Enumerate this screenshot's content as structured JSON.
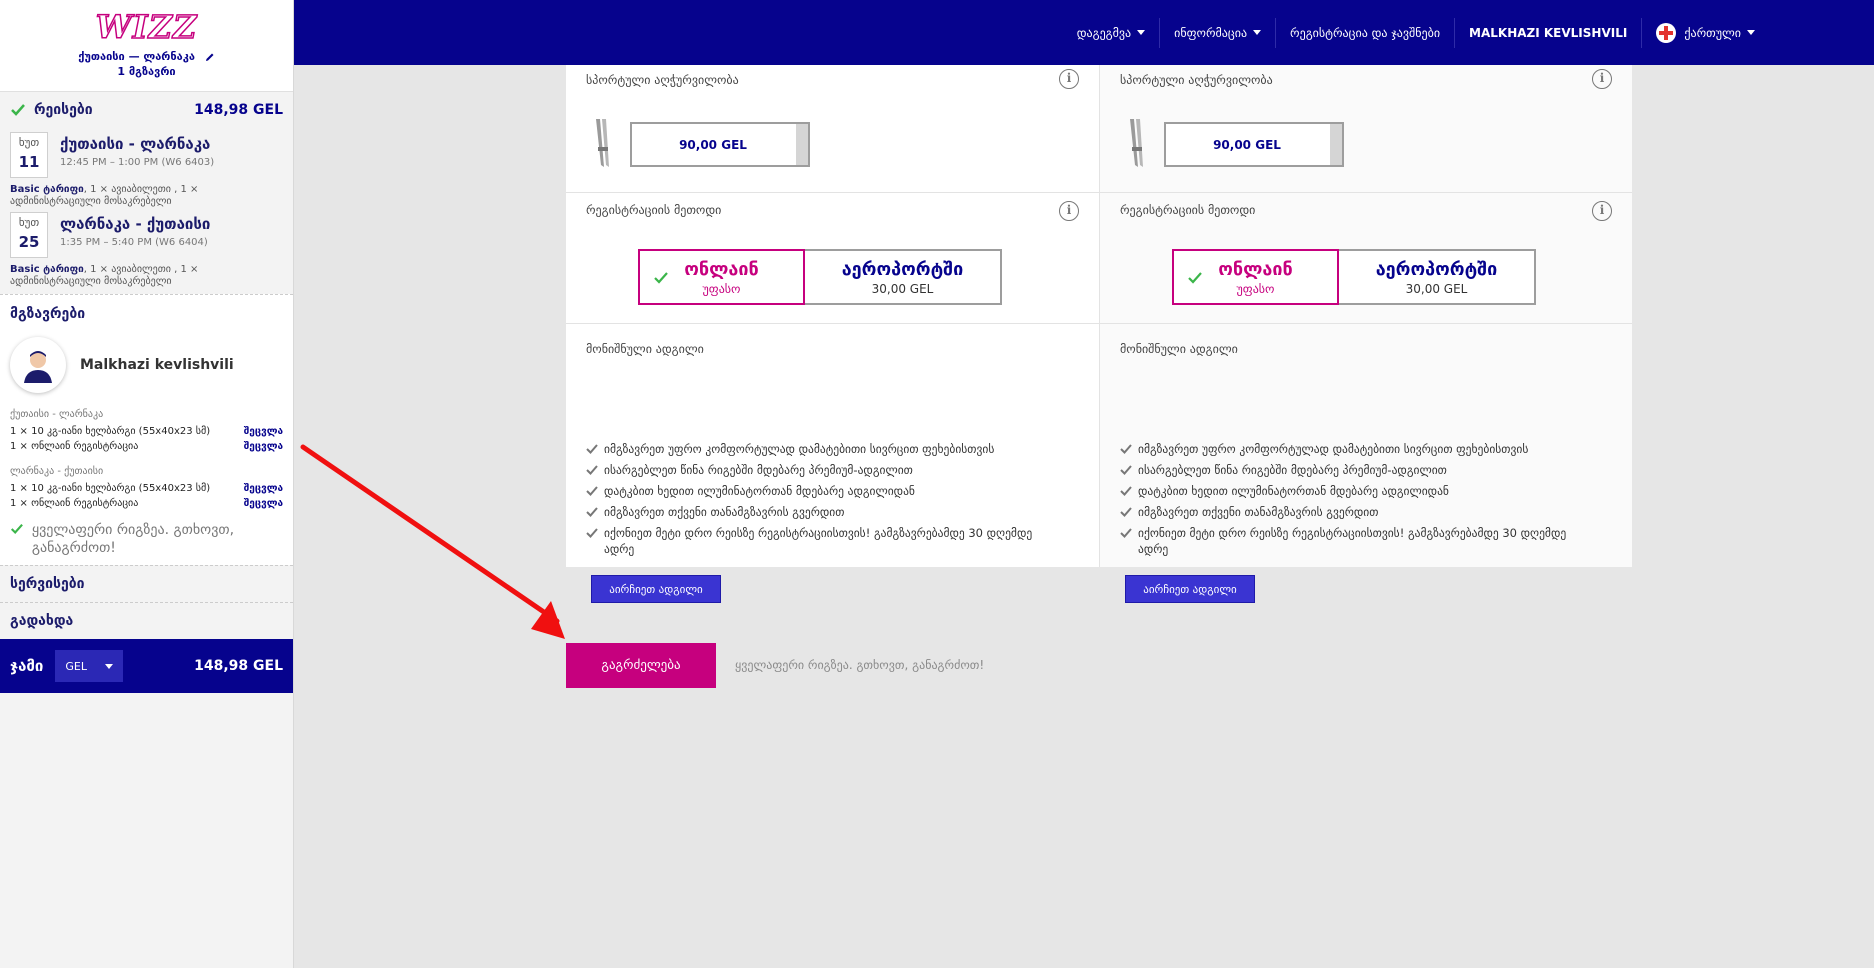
{
  "topbar": {
    "nav": [
      {
        "label": "დაგეგმვა",
        "caret": true
      },
      {
        "label": "ინფორმაცია",
        "caret": true
      },
      {
        "label": "რეგისტრაცია და ჯავშნები",
        "caret": false
      }
    ],
    "user": "MALKHAZI KEVLISHVILI",
    "language": "ქართული"
  },
  "sidebar": {
    "logo": "WIZZ",
    "route": "ქუთაისი — ლარნაკა",
    "pax_count": "1 მგზავრი",
    "flights_section": {
      "title": "რეისები",
      "price": "148,98 GEL"
    },
    "flights": [
      {
        "weekday": "ხუთ",
        "day": "11",
        "route": "ქუთაისი - ლარნაკა",
        "time": "12:45 PM – 1:00 PM (W6 6403)",
        "fare_bold": "Basic ტარიფი",
        "fare_rest": ", 1 × ავიაბილეთი , 1 × ადმინისტრაციული მოსაკრებელი"
      },
      {
        "weekday": "ხუთ",
        "day": "25",
        "route": "ლარნაკა - ქუთაისი",
        "time": "1:35 PM – 5:40 PM (W6 6404)",
        "fare_bold": "Basic ტარიფი",
        "fare_rest": ", 1 × ავიაბილეთი , 1 × ადმინისტრაციული მოსაკრებელი"
      }
    ],
    "passengers_title": "მგზავრები",
    "passenger_name": "Malkhazi kevlishvili",
    "legs": [
      {
        "title": "ქუთაისი - ლარნაკა",
        "services": [
          "1 × 10 კგ-იანი ხელბარგი (55x40x23 სმ)",
          "1 × ონლაინ რეგისტრაცია"
        ]
      },
      {
        "title": "ლარნაკა - ქუთაისი",
        "services": [
          "1 × 10 კგ-იანი ხელბარგი (55x40x23 სმ)",
          "1 × ონლაინ რეგისტრაცია"
        ]
      }
    ],
    "edit_label": "შეცვლა",
    "all_good": "ყველაფერი რიგზეა. გთხოვთ, განაგრძოთ!",
    "services_title": "სერვისები",
    "payment_title": "გადახდა",
    "total_label": "ჯამი",
    "currency": "GEL",
    "total_amount": "148,98 GEL"
  },
  "main": {
    "columns": [
      {
        "sport_title": "სპორტული აღჭურვილობა",
        "sport_price": "90,00 GEL",
        "reg_title": "რეგისტრაციის მეთოდი",
        "reg_online": "ონლაინ",
        "reg_online_sub": "უფასო",
        "reg_airport": "აეროპორტში",
        "reg_airport_sub": "30,00 GEL",
        "seat_title": "მონიშნული ადგილი",
        "seat_benefits": [
          "იმგზავრეთ უფრო კომფორტულად დამატებითი სივრცით ფეხებისთვის",
          "ისარგებლეთ წინა რიგებში მდებარე პრემიუმ-ადგილით",
          "დატკბით ხედით ილუმინატორთან მდებარე ადგილიდან",
          "იმგზავრეთ თქვენი თანამგზავრის გვერდით",
          "იქონიეთ მეტი დრო რეისზე რეგისტრაციისთვის! გამგზავრებამდე 30 დღემდე ადრე"
        ],
        "seat_button": "აირჩიეთ ადგილი"
      },
      {
        "sport_title": "სპორტული აღჭურვილობა",
        "sport_price": "90,00 GEL",
        "reg_title": "რეგისტრაციის მეთოდი",
        "reg_online": "ონლაინ",
        "reg_online_sub": "უფასო",
        "reg_airport": "აეროპორტში",
        "reg_airport_sub": "30,00 GEL",
        "seat_title": "მონიშნული ადგილი",
        "seat_benefits": [
          "იმგზავრეთ უფრო კომფორტულად დამატებითი სივრცით ფეხებისთვის",
          "ისარგებლეთ წინა რიგებში მდებარე პრემიუმ-ადგილით",
          "დატკბით ხედით ილუმინატორთან მდებარე ადგილიდან",
          "იმგზავრეთ თქვენი თანამგზავრის გვერდით",
          "იქონიეთ მეტი დრო რეისზე რეგისტრაციისთვის! გამგზავრებამდე 30 დღემდე ადრე"
        ],
        "seat_button": "აირჩიეთ ადგილი"
      }
    ],
    "continue_button": "გაგრძელება",
    "continue_hint": "ყველაფერი რიგზეა. გთხოვთ, განაგრძოთ!"
  },
  "colors": {
    "brand_blue": "#06038d",
    "brand_magenta": "#c6007e",
    "check_green": "#3bb54a",
    "annotation_arrow": "#f01010"
  }
}
